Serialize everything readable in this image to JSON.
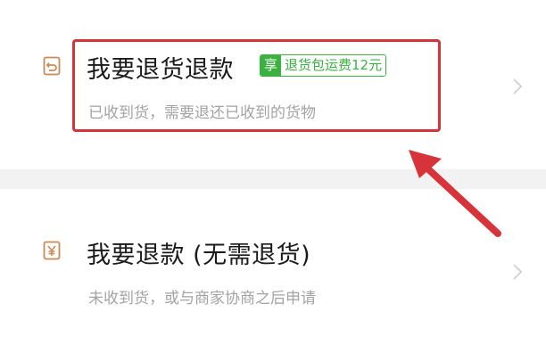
{
  "options": {
    "return_refund": {
      "icon": "return-box-icon",
      "title": "我要退货退款",
      "badge_tag": "享",
      "badge_text": "退货包运费12元",
      "subtitle": "已收到货，需要退还已收到的货物"
    },
    "refund_only": {
      "icon": "yen-receipt-icon",
      "title": "我要退款 (无需退货)",
      "subtitle": "未收到货，或与商家协商之后申请"
    }
  },
  "colors": {
    "badge_green": "#3bb13f",
    "highlight_red": "#d6343a",
    "icon_accent": "#c98a5a"
  }
}
